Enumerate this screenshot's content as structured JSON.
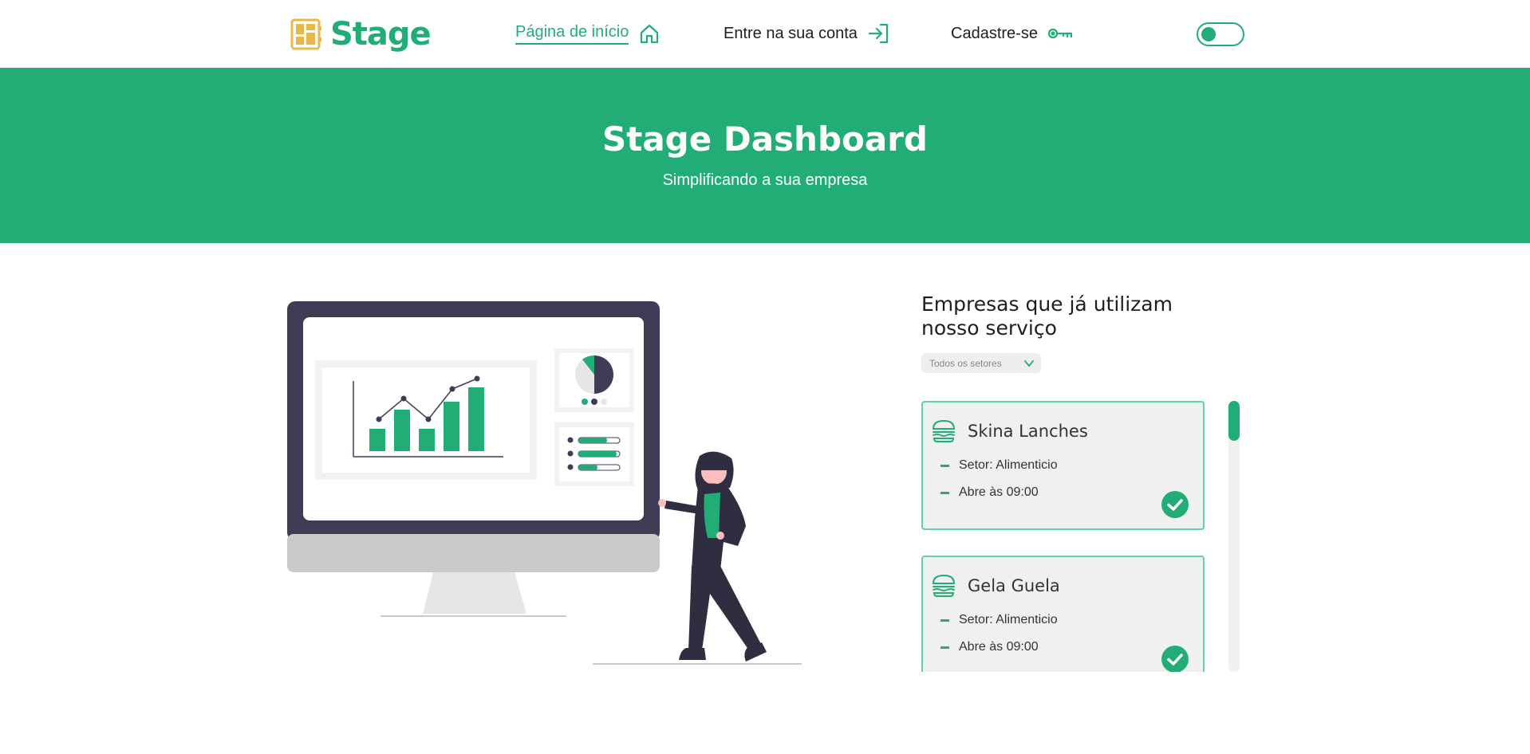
{
  "brand": {
    "name": "Stage",
    "accent": "#21ad75",
    "logo_color": "#e8b84b"
  },
  "nav": {
    "home": {
      "label": "Página de início",
      "icon": "home-icon"
    },
    "login": {
      "label": "Entre na sua conta",
      "icon": "login-icon"
    },
    "signup": {
      "label": "Cadastre-se",
      "icon": "key-icon"
    },
    "theme_toggle": {
      "state": "off"
    }
  },
  "hero": {
    "title": "Stage Dashboard",
    "subtitle": "Simplificando a sua empresa"
  },
  "companies": {
    "title": "Empresas que já utilizam nosso serviço",
    "filter": {
      "selected": "Todos os setores"
    },
    "items": [
      {
        "name": "Skina Lanches",
        "sector": "Setor: Alimenticio",
        "hours": "Abre às 09:00",
        "icon": "burger-icon",
        "verified": true
      },
      {
        "name": "Gela Guela",
        "sector": "Setor: Alimenticio",
        "hours": "Abre às 09:00",
        "icon": "burger-icon",
        "verified": true
      }
    ]
  }
}
